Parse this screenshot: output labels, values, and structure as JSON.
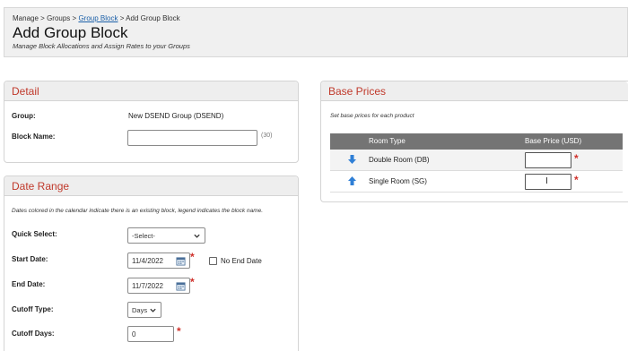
{
  "header": {
    "breadcrumb": [
      "Manage",
      "Groups",
      "Group Block",
      "Add Group Block"
    ],
    "separator": ">",
    "title": "Add Group Block",
    "subtitle": "Manage Block Allocations and Assign Rates to your Groups"
  },
  "detail": {
    "title": "Detail",
    "group_label": "Group:",
    "group_value": "New DSEND Group (DSEND)",
    "block_name_label": "Block Name:",
    "block_name_value": "",
    "block_name_hint": "(30)"
  },
  "date_range": {
    "title": "Date Range",
    "note": "Dates colored in the calendar indicate there is an existing block, legend indicates the block name.",
    "quick_select_label": "Quick Select:",
    "quick_select_value": "-Select-",
    "start_date_label": "Start Date:",
    "start_date_value": "11/4/2022",
    "no_end_date_label": "No End Date",
    "no_end_date_checked": false,
    "end_date_label": "End Date:",
    "end_date_value": "11/7/2022",
    "cutoff_type_label": "Cutoff Type:",
    "cutoff_type_value": "Days",
    "cutoff_days_label": "Cutoff Days:",
    "cutoff_days_value": "0"
  },
  "base_prices": {
    "title": "Base Prices",
    "note": "Set base prices for each product",
    "columns": [
      "Room Type",
      "Base Price (USD)"
    ],
    "rows": [
      {
        "room_type": "Double Room (DB)",
        "arrow_icon": "arrow-down-icon",
        "price": ""
      },
      {
        "room_type": "Single Room (SG)",
        "arrow_icon": "arrow-up-icon",
        "price": ""
      }
    ]
  },
  "colors": {
    "accent": "#c0392b",
    "required": "#d0302a",
    "link": "#1a5fa8",
    "table_header": "#747474",
    "arrow": "#2f7fd6"
  },
  "required_mark": "*"
}
